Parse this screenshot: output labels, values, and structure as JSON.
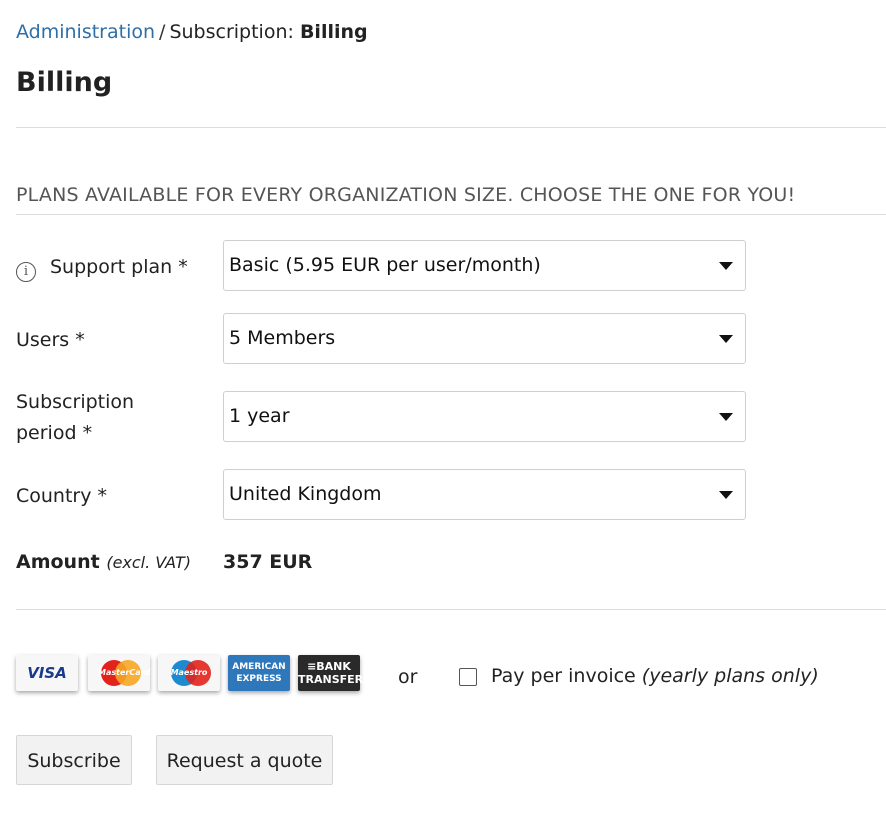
{
  "breadcrumb": {
    "root": "Administration",
    "separator": "/",
    "prefix": "Subscription:",
    "current": "Billing"
  },
  "page_title": "Billing",
  "section_title": "PLANS AVAILABLE FOR EVERY ORGANIZATION SIZE. CHOOSE THE ONE FOR YOU!",
  "form": {
    "support_plan": {
      "label": "Support plan *",
      "value": "Basic (5.95 EUR per user/month)"
    },
    "users": {
      "label": "Users *",
      "value": "5 Members"
    },
    "subscription_period": {
      "label_line1": "Subscription",
      "label_line2": "period *",
      "value": "1 year"
    },
    "country": {
      "label": "Country *",
      "value": "United Kingdom"
    }
  },
  "amount": {
    "label": "Amount",
    "note": "(excl. VAT)",
    "value": "357 EUR"
  },
  "payment": {
    "cards": {
      "visa": "VISA",
      "mastercard": "MasterCard",
      "maestro": "Maestro",
      "amex_line1": "AMERICAN",
      "amex_line2": "EXPRESS",
      "bank_line1": "≡BANK",
      "bank_line2": "TRANSFER"
    },
    "or": "or",
    "pay_per_invoice": "Pay per invoice",
    "pay_per_invoice_note": "(yearly plans only)",
    "pay_per_invoice_checked": false
  },
  "buttons": {
    "subscribe": "Subscribe",
    "request_quote": "Request a quote"
  },
  "colors": {
    "link": "#2f6fa7",
    "amex": "#2e77bb",
    "bank": "#2a2a2a"
  }
}
